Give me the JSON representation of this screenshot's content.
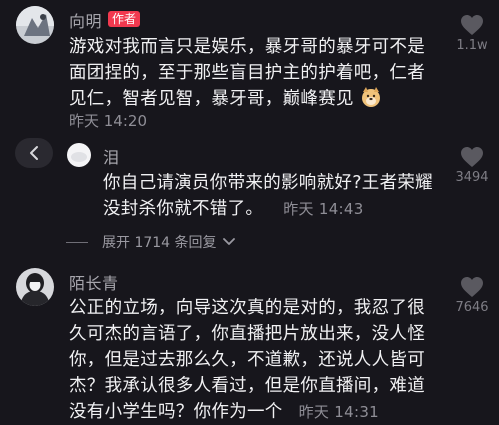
{
  "comments": [
    {
      "user": "向明",
      "badge": "作者",
      "lines": [
        "游戏对我而言只是娱乐，暴牙哥的暴牙可不是",
        "面团捏的，至于那些盲目护主的护着吧，仁者",
        "见仁，智者见智，暴牙哥，巅峰赛见"
      ],
      "time": "昨天 14:20",
      "likes": "1.1w"
    },
    {
      "user": "泪",
      "lines": [
        "你自己请演员你带来的影响就好?王者荣耀",
        "没封杀你就不错了。"
      ],
      "time": "昨天 14:43",
      "likes": "3494"
    },
    {
      "user": "陌长青",
      "lines": [
        "公正的立场，向导这次真的是对的，我忍了很",
        "久可杰的言语了，你直播把片放出来，没人怪",
        "你，但是过去那么久，不道歉，还说人人皆可",
        "杰？我承认很多人看过，但是你直播间，难道",
        "没有小学生吗？你作为一个"
      ],
      "time": "昨天 14:31",
      "likes": "7646"
    }
  ],
  "expand_label": "展开 1714 条回复",
  "colors": {
    "background": "#17161c",
    "badge": "#f2394f",
    "muted_text": "#a7a6ad"
  }
}
